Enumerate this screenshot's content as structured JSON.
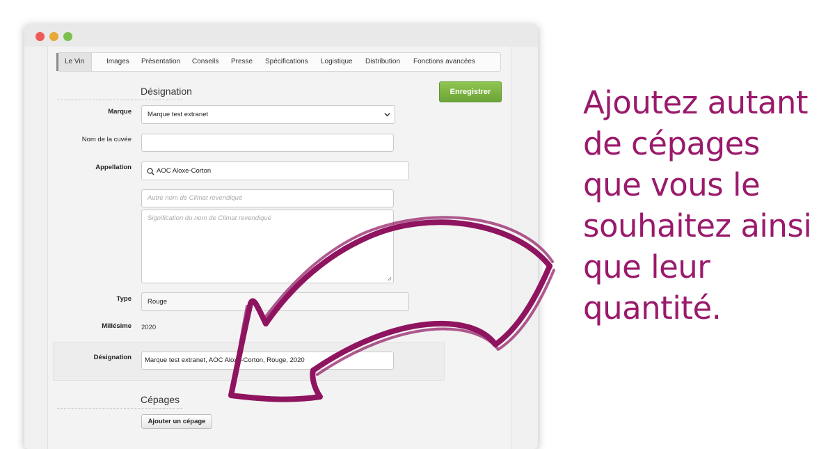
{
  "tabs": [
    "Le Vin",
    "Images",
    "Présentation",
    "Conseils",
    "Presse",
    "Spécifications",
    "Logistique",
    "Distribution",
    "Fonctions avancées"
  ],
  "active_tab": "Le Vin",
  "designation_section": {
    "title": "Désignation",
    "save_label": "Enregistrer"
  },
  "form": {
    "marque": {
      "label": "Marque",
      "value": "Marque test extranet"
    },
    "nom_cuvee": {
      "label": "Nom de la cuvée",
      "value": ""
    },
    "appellation": {
      "label": "Appellation",
      "value": "AOC Aloxe-Corton"
    },
    "climat_nom": {
      "placeholder": "Autre nom de Climat revendiqué"
    },
    "climat_signification": {
      "placeholder": "Signification du nom de Climat revendiqué"
    },
    "type": {
      "label": "Type",
      "value": "Rouge"
    },
    "millesime": {
      "label": "Millésime",
      "value": "2020"
    },
    "designation": {
      "label": "Désignation",
      "value": "Marque test extranet, AOC Aloxe-Corton, Rouge, 2020"
    }
  },
  "cepages_section": {
    "title": "Cépages",
    "add_label": "Ajouter un cépage"
  },
  "promo": {
    "lines": [
      "Ajoutez autant",
      "de cépages",
      "que vous le",
      "souhaitez ainsi",
      "que leur",
      "quantité."
    ]
  },
  "colors": {
    "accent": "#9a1a6b",
    "save_green": "#7cb342"
  },
  "icons": {
    "search": "search-icon",
    "select_chevron": "chevron-down-icon",
    "window_close": "window-close-dot",
    "window_minimize": "window-minimize-dot",
    "window_maximize": "window-maximize-dot",
    "arrow": "curved-arrow"
  }
}
